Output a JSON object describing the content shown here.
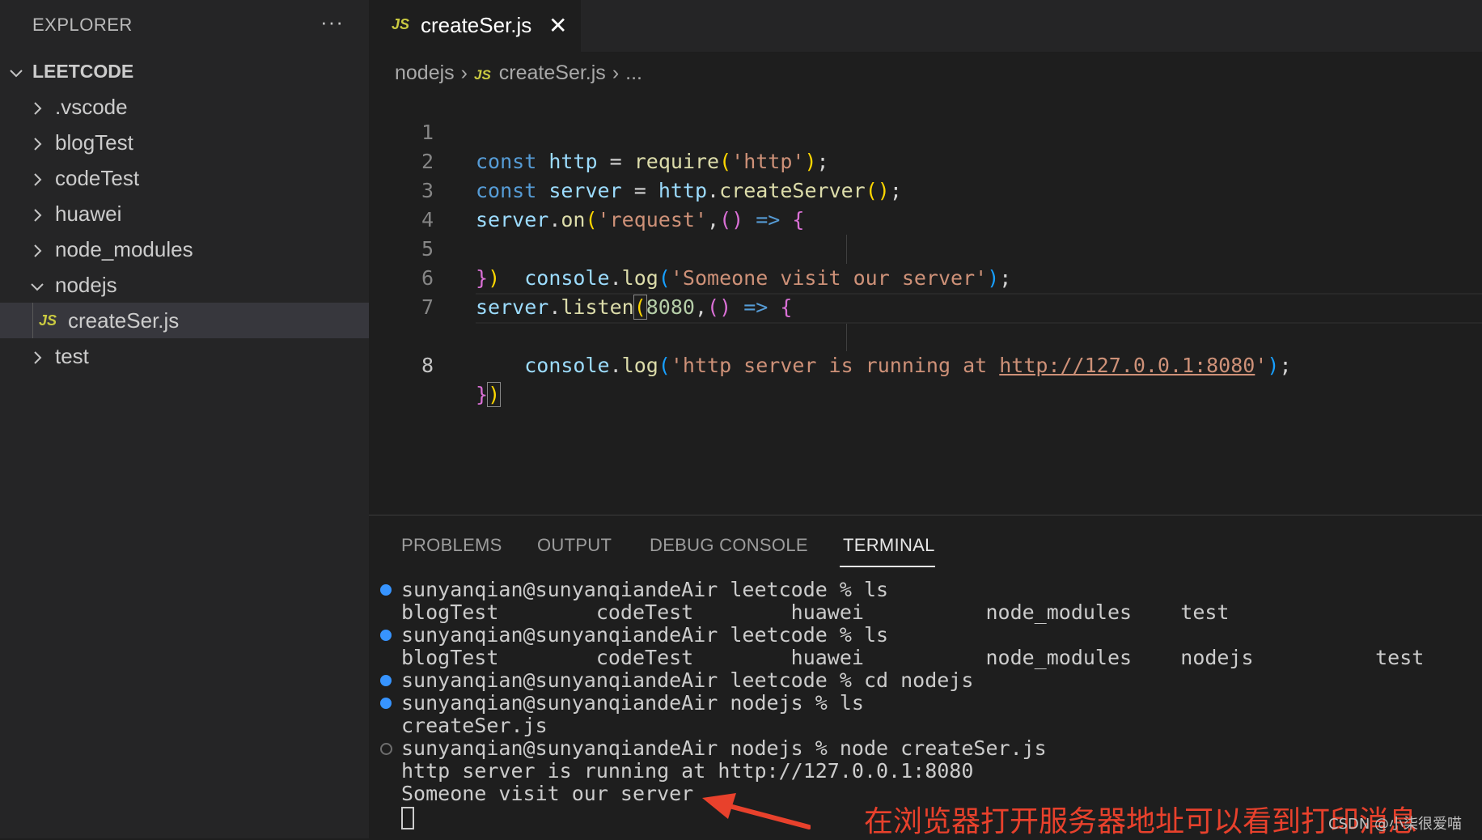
{
  "explorer": {
    "title": "EXPLORER",
    "more": "···",
    "root": "LEETCODE",
    "items": [
      {
        "label": ".vscode",
        "type": "folder",
        "expanded": false
      },
      {
        "label": "blogTest",
        "type": "folder",
        "expanded": false
      },
      {
        "label": "codeTest",
        "type": "folder",
        "expanded": false
      },
      {
        "label": "huawei",
        "type": "folder",
        "expanded": false
      },
      {
        "label": "node_modules",
        "type": "folder",
        "expanded": false
      },
      {
        "label": "nodejs",
        "type": "folder",
        "expanded": true
      },
      {
        "label": "createSer.js",
        "type": "file",
        "badge": "JS",
        "active": true
      },
      {
        "label": "test",
        "type": "folder",
        "expanded": false
      }
    ]
  },
  "tab": {
    "badge": "JS",
    "title": "createSer.js",
    "close": "✕"
  },
  "breadcrumb": {
    "folder": "nodejs",
    "badge": "JS",
    "file": "createSer.js",
    "more": "..."
  },
  "editor": {
    "line_numbers": [
      "1",
      "2",
      "3",
      "4",
      "5",
      "6",
      "7",
      "8"
    ],
    "current_line": "8"
  },
  "panel": {
    "tabs": [
      "PROBLEMS",
      "OUTPUT",
      "DEBUG CONSOLE",
      "TERMINAL"
    ],
    "active_tab": "TERMINAL",
    "terminal_lines": [
      "sunyanqian@sunyanqiandeAir leetcode % ls",
      "blogTest        codeTest        huawei          node_modules    test",
      "sunyanqian@sunyanqiandeAir leetcode % ls",
      "blogTest        codeTest        huawei          node_modules    nodejs          test",
      "sunyanqian@sunyanqiandeAir leetcode % cd nodejs",
      "sunyanqian@sunyanqiandeAir nodejs % ls",
      "createSer.js",
      "sunyanqian@sunyanqiandeAir nodejs % node createSer.js",
      "http server is running at http://127.0.0.1:8080",
      "Someone visit our server"
    ]
  },
  "annotation": {
    "text": "在浏览器打开服务器地址可以看到打印消息",
    "color": "#e8412c"
  },
  "watermark": "CSDN @小柒很爱喵",
  "colors": {
    "keyword": "#569cd6",
    "variable": "#9cdcfe",
    "function": "#dcdcaa",
    "string": "#ce9178",
    "number": "#b5cea8",
    "status_dot": "#3794ff"
  }
}
